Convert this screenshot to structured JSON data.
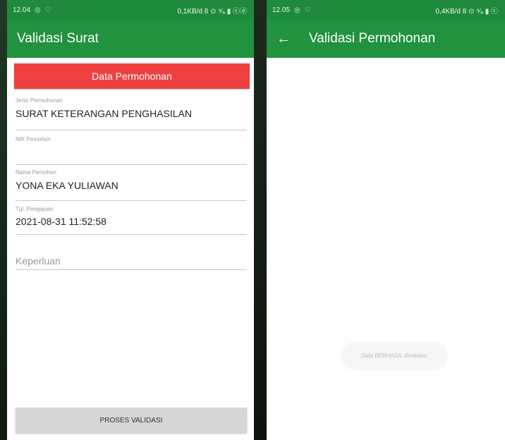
{
  "left": {
    "status": {
      "time": "12.04",
      "right": "0,1KB/d 8 ⊙ ⁴⁄ₐ ▮ ⓒⓓ"
    },
    "title": "Validasi Surat",
    "section_header": "Data Permohonan",
    "fields": {
      "jenis": {
        "label": "Jenis Permohonan",
        "value": "SURAT KETERANGAN PENGHASILAN"
      },
      "nik": {
        "label": "NIK Pemohon",
        "value": ""
      },
      "nama": {
        "label": "Nama Pemohon",
        "value": "YONA EKA YULIAWAN"
      },
      "tgl": {
        "label": "Tgl. Pengajuan",
        "value": "2021-08-31 11:52:58"
      },
      "keperluan": {
        "placeholder": "Keperluan"
      }
    },
    "button_label": "PROSES VALIDASI"
  },
  "right": {
    "status": {
      "time": "12.05",
      "right": "0,4KB/d 8 ⊙ ⁴⁄ₐ ▮ ⓒ"
    },
    "title": "Validasi Permohonan",
    "toast": "Data BERHASIL divalidasi"
  },
  "colors": {
    "statusbar": "#1f8a3b",
    "appbar": "#21923e",
    "header_red": "#ee4040"
  }
}
